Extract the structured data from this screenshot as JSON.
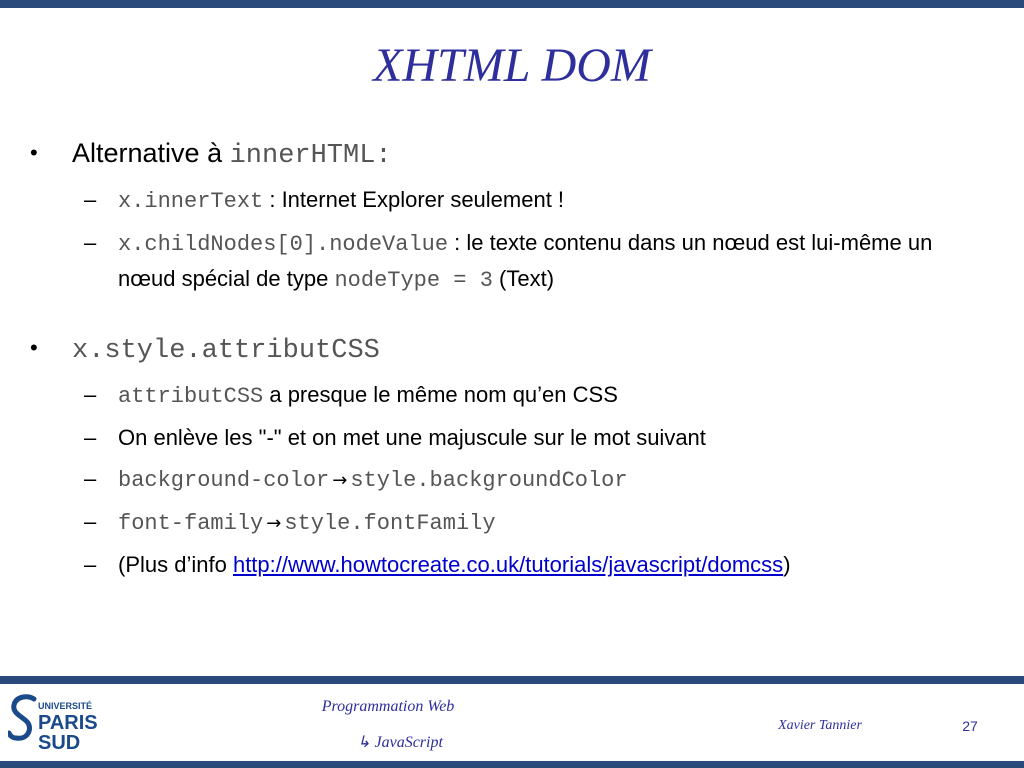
{
  "slide": {
    "title": "XHTML DOM",
    "bullet_symbol": "•",
    "dash_symbol": "–",
    "arrow_symbol": "→",
    "items": [
      {
        "text": "Alternative à ",
        "code": "innerHTML",
        "suffix": ":",
        "subitems": [
          {
            "code": "x.innerText",
            "text": " : Internet Explorer seulement !"
          },
          {
            "code": "x.childNodes[0].nodeValue",
            "text": " : le texte contenu dans un nœud est lui-même un nœud spécial de type ",
            "code2": "nodeType = 3",
            "text2": " (Text)"
          }
        ]
      },
      {
        "code": "x.style.attributCSS",
        "subitems": [
          {
            "code": "attributCSS",
            "text": " a presque le même nom qu’en CSS"
          },
          {
            "text": "On enlève les \"-\"  et on met une majuscule sur le mot suivant"
          },
          {
            "code": "background-color",
            "code2": "style.backgroundColor"
          },
          {
            "code": "font-family",
            "code2": "style.fontFamily"
          },
          {
            "text": "(Plus d’info ",
            "link": "http://www.howtocreate.co.uk/tutorials/javascript/domcss",
            "text2": ")"
          }
        ]
      }
    ]
  },
  "footer": {
    "course": "Programmation Web",
    "topic_icon": "arrow-hook-icon",
    "topic_symbol": "↳",
    "topic": " JavaScript",
    "author": "Xavier Tannier",
    "page_number": "27",
    "logo": {
      "line1": "UNIVERSITÉ",
      "line2": "PARIS",
      "line3": "SUD"
    }
  },
  "colors": {
    "title": "#2e2f9c",
    "rules": "#2a4a7c",
    "code": "#555555",
    "link": "#0000cc",
    "logo": "#1a4a8a"
  }
}
